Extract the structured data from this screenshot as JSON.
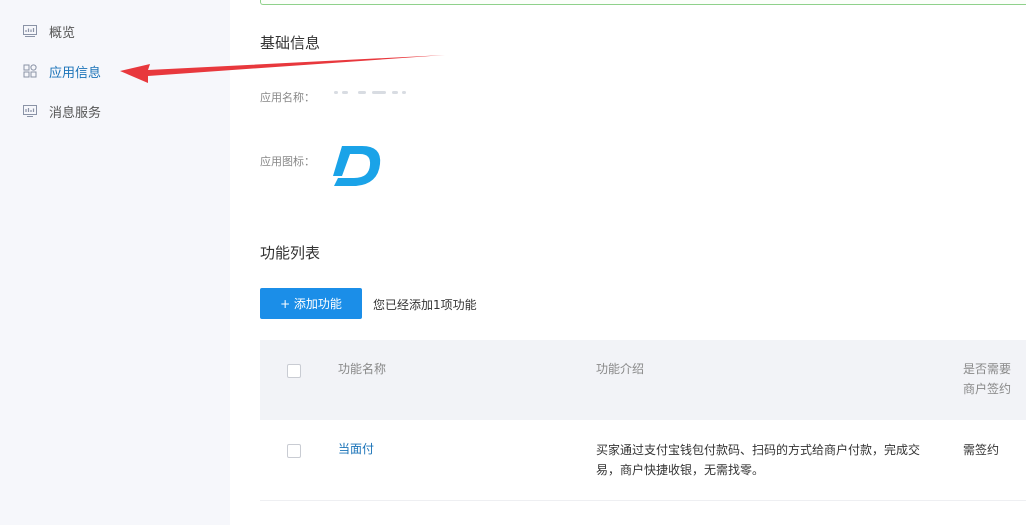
{
  "sidebar": {
    "items": [
      {
        "label": "概览",
        "icon": "dashboard-icon",
        "active": false
      },
      {
        "label": "应用信息",
        "icon": "apps-grid-icon",
        "active": true
      },
      {
        "label": "消息服务",
        "icon": "message-monitor-icon",
        "active": false
      }
    ]
  },
  "basic_info": {
    "title": "基础信息",
    "app_name_label": "应用名称：",
    "app_icon_label": "应用图标："
  },
  "features": {
    "title": "功能列表",
    "add_button": "+ 添加功能",
    "added_hint": "您已经添加1项功能",
    "columns": {
      "name": "功能名称",
      "intro": "功能介绍",
      "sign_line1": "是否需要",
      "sign_line2": "商户签约"
    },
    "rows": [
      {
        "name": "当面付",
        "intro_line1": "买家通过支付宝钱包付款码、扫码的方式给商户付款，完成交",
        "intro_line2": "易，商户快捷收银，无需找零。",
        "sign": "需签约"
      }
    ]
  },
  "colors": {
    "accent": "#1b8ee8",
    "link": "#1a73b8",
    "arrow": "#e8383d",
    "logo": "#1aa3e8"
  }
}
